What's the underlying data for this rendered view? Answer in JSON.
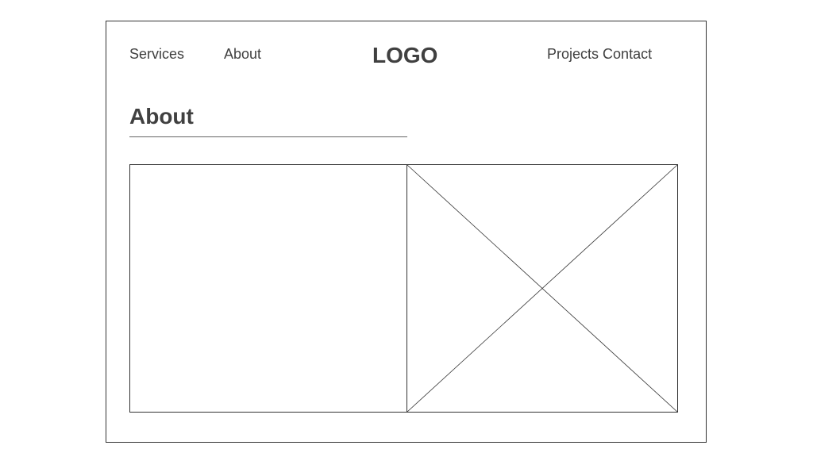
{
  "nav": {
    "left_items": [
      "Services",
      "About"
    ],
    "right_items": [
      "Projects",
      "Contact"
    ]
  },
  "logo": {
    "text": "LOGO"
  },
  "section": {
    "title": "About"
  },
  "placeholder": {
    "icon": "image-placeholder-icon"
  },
  "colors": {
    "text": "#404040",
    "stroke": "#333333",
    "background": "#ffffff"
  }
}
